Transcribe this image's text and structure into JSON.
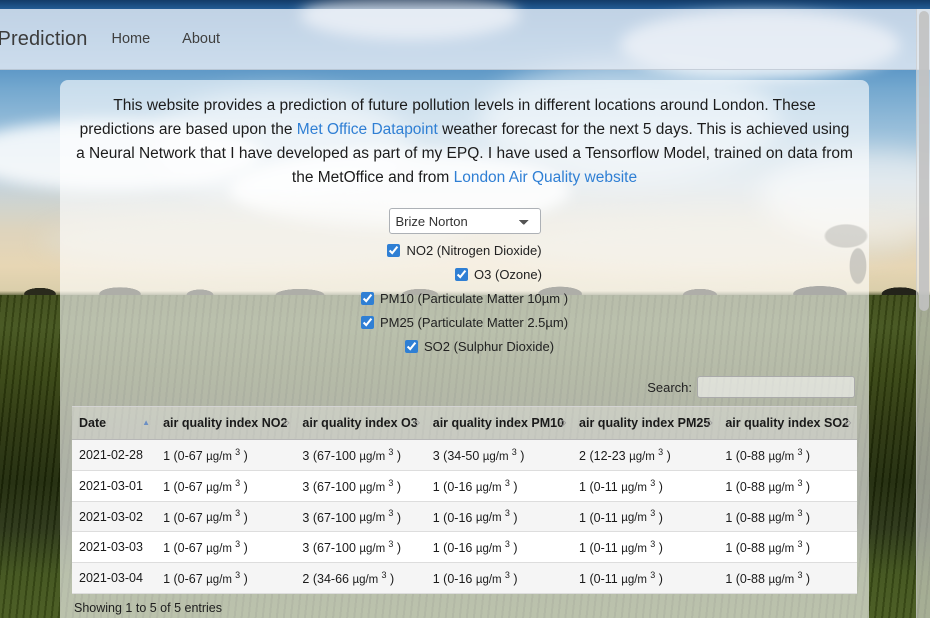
{
  "navbar": {
    "brand": "ution Prediction",
    "links": [
      {
        "label": "Home"
      },
      {
        "label": "About"
      }
    ]
  },
  "intro": {
    "part1": "This website provides a prediction of future pollution levels in different locations around London. These predictions are based upon the ",
    "link1": "Met Office Datapoint",
    "part2": " weather forecast for the next 5 days. This is achieved using a Neural Network that I have developed as part of my EPQ. I have used a Tensorflow Model, trained on data from the MetOffice and from ",
    "link2": "London Air Quality website",
    "link_color": "#2f7fd4"
  },
  "controls": {
    "location_select": {
      "selected": "Brize Norton",
      "options": [
        "Brize Norton"
      ]
    },
    "pollutants": [
      {
        "label": "NO2 (Nitrogen Dioxide)",
        "checked": true,
        "indent": 0
      },
      {
        "label": "O3 (Ozone)",
        "checked": true,
        "indent": 34
      },
      {
        "label": "PM10 (Particulate Matter 10µm )",
        "checked": true,
        "indent": -16
      },
      {
        "label": "PM25 (Particulate Matter 2.5µm)",
        "checked": true,
        "indent": -18
      },
      {
        "label": "SO2 (Sulphur Dioxide)",
        "checked": true,
        "indent": 14
      }
    ]
  },
  "search": {
    "label": "Search:",
    "value": "",
    "placeholder": ""
  },
  "table": {
    "columns": [
      {
        "label": "Date",
        "sorted": "asc"
      },
      {
        "label": "air quality index NO2",
        "sorted": "none"
      },
      {
        "label": "air quality index O3",
        "sorted": "none"
      },
      {
        "label": "air quality index PM10",
        "sorted": "none"
      },
      {
        "label": "air quality index PM25",
        "sorted": "none"
      },
      {
        "label": "air quality index SO2",
        "sorted": "none"
      }
    ],
    "rows": [
      {
        "date": "2021-02-28",
        "no2": {
          "index": "1",
          "range": "0-67"
        },
        "o3": {
          "index": "3",
          "range": "67-100"
        },
        "pm10": {
          "index": "3",
          "range": "34-50"
        },
        "pm25": {
          "index": "2",
          "range": "12-23"
        },
        "so2": {
          "index": "1",
          "range": "0-88"
        }
      },
      {
        "date": "2021-03-01",
        "no2": {
          "index": "1",
          "range": "0-67"
        },
        "o3": {
          "index": "3",
          "range": "67-100"
        },
        "pm10": {
          "index": "1",
          "range": "0-16"
        },
        "pm25": {
          "index": "1",
          "range": "0-11"
        },
        "so2": {
          "index": "1",
          "range": "0-88"
        }
      },
      {
        "date": "2021-03-02",
        "no2": {
          "index": "1",
          "range": "0-67"
        },
        "o3": {
          "index": "3",
          "range": "67-100"
        },
        "pm10": {
          "index": "1",
          "range": "0-16"
        },
        "pm25": {
          "index": "1",
          "range": "0-11"
        },
        "so2": {
          "index": "1",
          "range": "0-88"
        }
      },
      {
        "date": "2021-03-03",
        "no2": {
          "index": "1",
          "range": "0-67"
        },
        "o3": {
          "index": "3",
          "range": "67-100"
        },
        "pm10": {
          "index": "1",
          "range": "0-16"
        },
        "pm25": {
          "index": "1",
          "range": "0-11"
        },
        "so2": {
          "index": "1",
          "range": "0-88"
        }
      },
      {
        "date": "2021-03-04",
        "no2": {
          "index": "1",
          "range": "0-67"
        },
        "o3": {
          "index": "2",
          "range": "34-66"
        },
        "pm10": {
          "index": "1",
          "range": "0-16"
        },
        "pm25": {
          "index": "1",
          "range": "0-11"
        },
        "so2": {
          "index": "1",
          "range": "0-88"
        }
      }
    ],
    "unit_prefix": "µg/m",
    "unit_exponent": "3",
    "info": "Showing 1 to 5 of 5 entries"
  }
}
